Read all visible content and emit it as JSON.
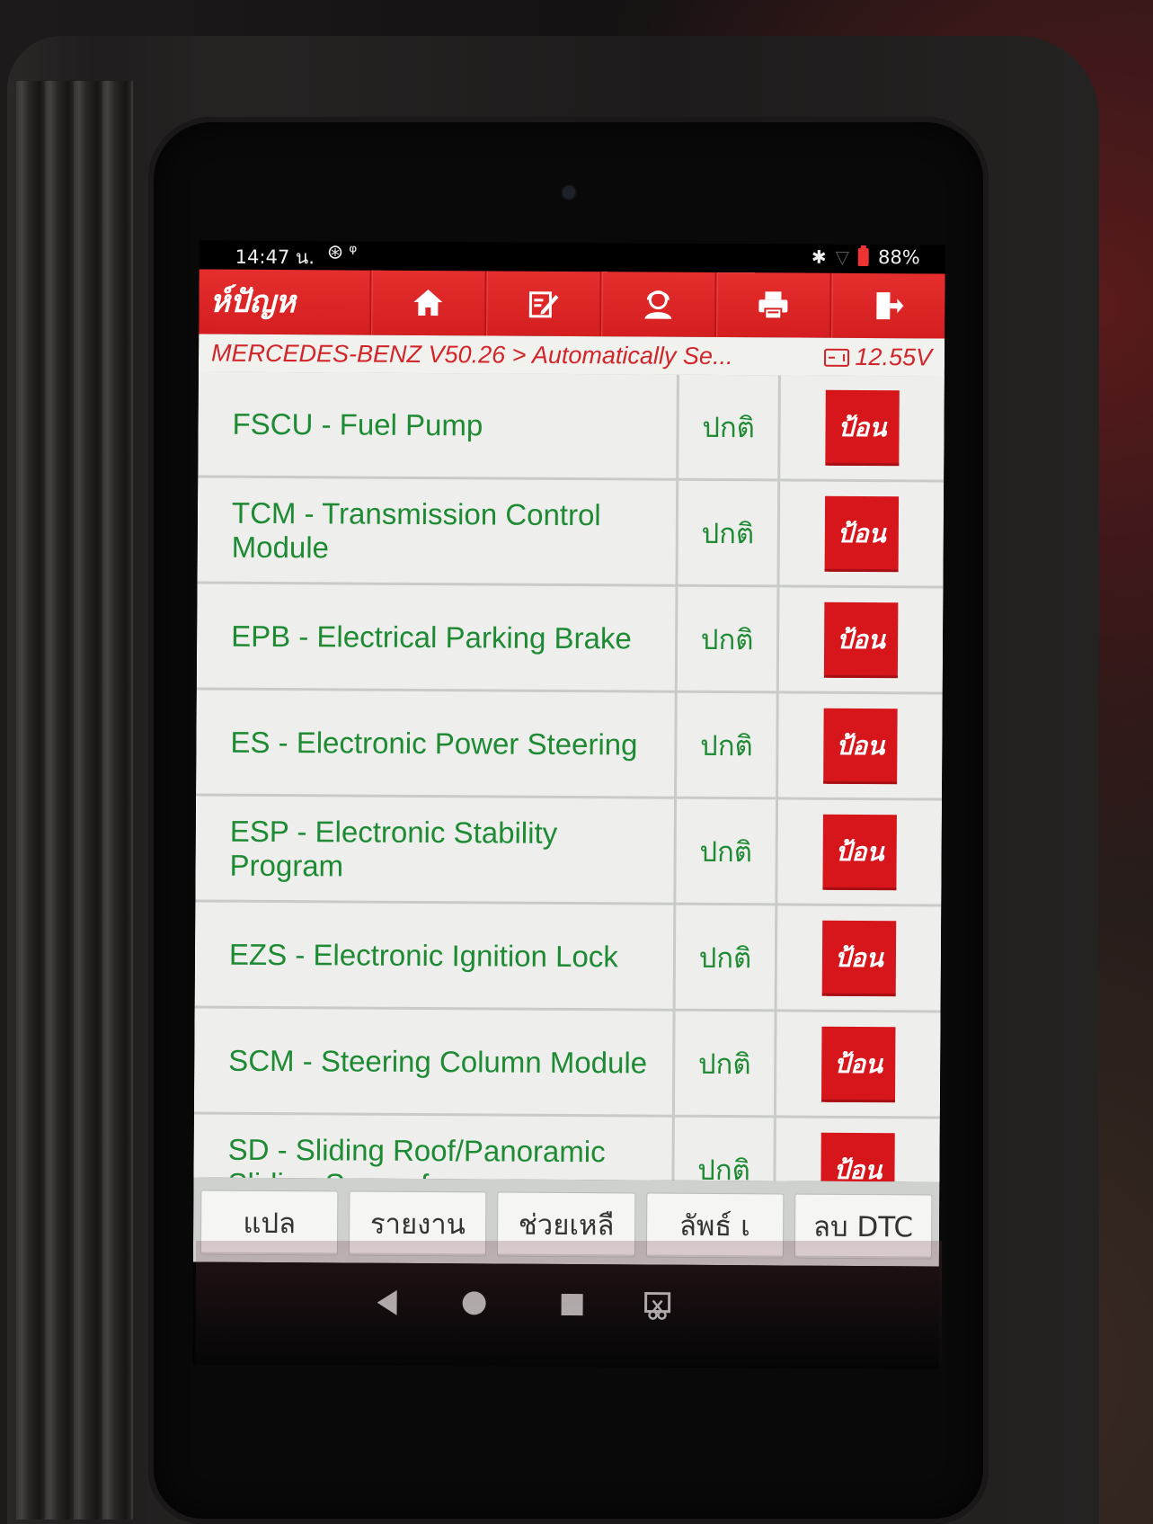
{
  "status_bar": {
    "time": "14:47 น.",
    "left_icons": [
      "alarm-icon",
      "usb-icon"
    ],
    "right_icons": [
      "bluetooth-icon",
      "wifi-icon",
      "battery-icon"
    ],
    "battery_level": "88%"
  },
  "toolbar": {
    "title": "ห์ปัญห",
    "buttons": [
      {
        "icon": "home-icon"
      },
      {
        "icon": "edit-icon"
      },
      {
        "icon": "user-support-icon"
      },
      {
        "icon": "print-icon"
      },
      {
        "icon": "exit-icon"
      }
    ]
  },
  "breadcrumb": {
    "path": "MERCEDES-BENZ V50.26 > Automatically Se...",
    "voltage": "12.55V"
  },
  "modules": [
    {
      "name": "FSCU - Fuel Pump",
      "status": "ปกติ",
      "action": "ป้อน"
    },
    {
      "name": "TCM - Transmission Control Module",
      "status": "ปกติ",
      "action": "ป้อน"
    },
    {
      "name": "EPB - Electrical Parking Brake",
      "status": "ปกติ",
      "action": "ป้อน"
    },
    {
      "name": "ES - Electronic Power Steering",
      "status": "ปกติ",
      "action": "ป้อน"
    },
    {
      "name": "ESP - Electronic Stability Program",
      "status": "ปกติ",
      "action": "ป้อน"
    },
    {
      "name": "EZS - Electronic Ignition Lock",
      "status": "ปกติ",
      "action": "ป้อน"
    },
    {
      "name": "SCM - Steering Column Module",
      "status": "ปกติ",
      "action": "ป้อน"
    },
    {
      "name": "SD - Sliding Roof/Panoramic Sliding Sunroof",
      "status": "ปกติ",
      "action": "ป้อน"
    }
  ],
  "bottom_bar": {
    "translate_label": "แปล",
    "report_label": "รายงาน",
    "help_label": "ช่วยเหลื",
    "symbol_label": "ลัพธ์   เ",
    "clear_dtc_label": "ลบ DTC"
  },
  "nav_bar": {
    "icons": [
      "back-icon",
      "home-circle-icon",
      "recents-icon",
      "screenshot-icon"
    ]
  },
  "colors": {
    "brand_red": "#d7161c",
    "module_text_green": "#1e8a33",
    "breadcrumb_red": "#d1252a",
    "row_background": "#eeefec"
  }
}
